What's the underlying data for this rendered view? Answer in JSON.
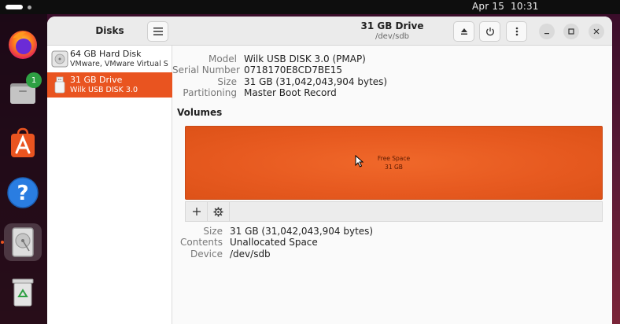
{
  "topbar": {
    "date": "Apr 15",
    "time": "10:31"
  },
  "dock": {
    "files_badge": "1",
    "items": [
      "firefox-icon",
      "files-icon",
      "app-center-icon",
      "help-icon",
      "disks-icon",
      "trash-icon"
    ]
  },
  "sidebar": {
    "title": "Disks",
    "disks": [
      {
        "name": "64 GB Hard Disk",
        "subtitle": "VMware, VMware Virtual S",
        "icon": "hard-disk-icon",
        "selected": false
      },
      {
        "name": "31 GB Drive",
        "subtitle": "Wilk USB DISK 3.0",
        "icon": "usb-drive-icon",
        "selected": true
      }
    ]
  },
  "header": {
    "title": "31 GB Drive",
    "subtitle": "/dev/sdb"
  },
  "drive_info": {
    "model_label": "Model",
    "model": "Wilk USB DISK 3.0 (PMAP)",
    "serial_label": "Serial Number",
    "serial": "0718170E8CD7BE15",
    "size_label": "Size",
    "size": "31 GB (31,042,043,904 bytes)",
    "partitioning_label": "Partitioning",
    "partitioning": "Master Boot Record"
  },
  "volumes": {
    "title": "Volumes",
    "block_name": "Free Space",
    "block_size": "31 GB"
  },
  "volume_info": {
    "size_label": "Size",
    "size": "31 GB (31,042,043,904 bytes)",
    "contents_label": "Contents",
    "contents": "Unallocated Space",
    "device_label": "Device",
    "device": "/dev/sdb"
  },
  "colors": {
    "accent": "#e95420",
    "volume": "#e75a20"
  }
}
